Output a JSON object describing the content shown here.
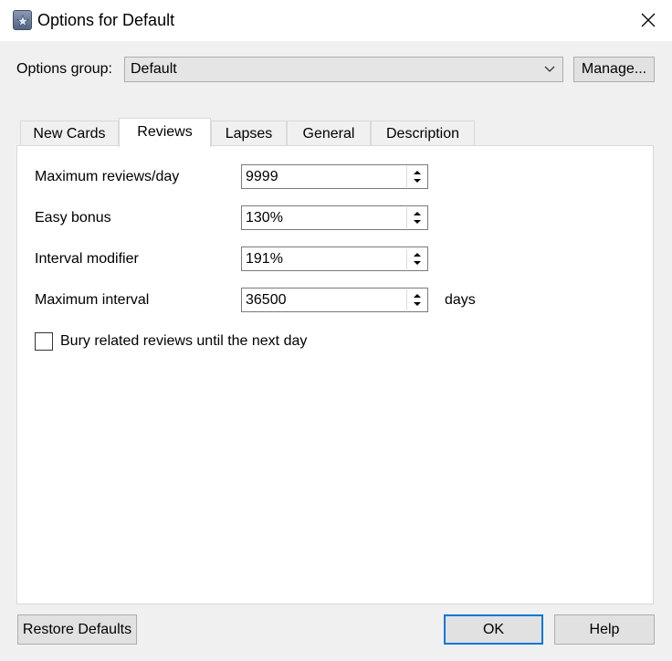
{
  "window": {
    "title": "Options for Default",
    "icon": "anki-icon",
    "close_icon": "close-icon"
  },
  "options_group": {
    "label": "Options group:",
    "value": "Default",
    "manage_label": "Manage..."
  },
  "tabs": [
    {
      "label": "New Cards",
      "active": false
    },
    {
      "label": "Reviews",
      "active": true
    },
    {
      "label": "Lapses",
      "active": false
    },
    {
      "label": "General",
      "active": false
    },
    {
      "label": "Description",
      "active": false
    }
  ],
  "reviews": {
    "fields": [
      {
        "label": "Maximum reviews/day",
        "value": "9999"
      },
      {
        "label": "Easy bonus",
        "value": "130%"
      },
      {
        "label": "Interval modifier",
        "value": "191%"
      },
      {
        "label": "Maximum interval",
        "value": "36500",
        "unit": "days"
      }
    ],
    "bury_checkbox": {
      "label": "Bury related reviews until the next day",
      "checked": false
    }
  },
  "buttons": {
    "restore": "Restore Defaults",
    "ok": "OK",
    "help": "Help"
  },
  "colors": {
    "accent": "#0078d7",
    "panel": "#ffffff",
    "background": "#f0f0f0"
  }
}
